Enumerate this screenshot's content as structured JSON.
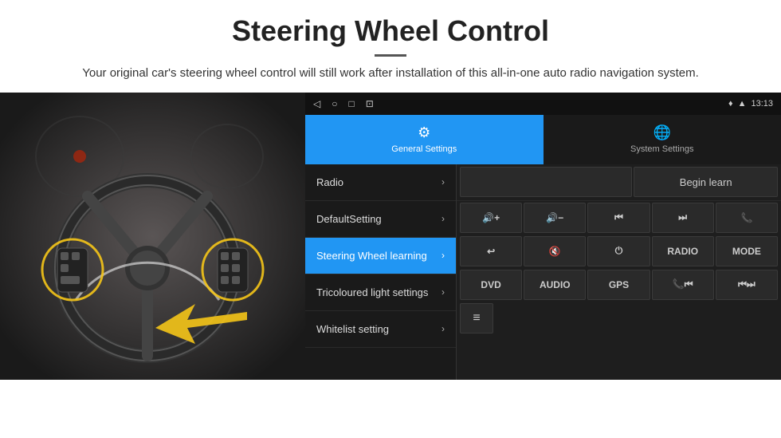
{
  "header": {
    "title": "Steering Wheel Control",
    "description": "Your original car's steering wheel control will still work after installation of this all-in-one auto radio navigation system."
  },
  "status_bar": {
    "time": "13:13",
    "nav_icons": [
      "◁",
      "○",
      "□",
      "⊡"
    ]
  },
  "tabs": [
    {
      "label": "General Settings",
      "icon": "⚙",
      "active": true
    },
    {
      "label": "System Settings",
      "icon": "🌐",
      "active": false
    }
  ],
  "menu_items": [
    {
      "label": "Radio",
      "active": false
    },
    {
      "label": "DefaultSetting",
      "active": false
    },
    {
      "label": "Steering Wheel learning",
      "active": true
    },
    {
      "label": "Tricoloured light settings",
      "active": false
    },
    {
      "label": "Whitelist setting",
      "active": false
    }
  ],
  "panel": {
    "begin_learn": "Begin learn",
    "buttons_row2": [
      "🔊+",
      "🔊—",
      "⏮",
      "⏭",
      "📞"
    ],
    "buttons_row3": [
      "↩",
      "🔊✕",
      "⏻",
      "RADIO",
      "MODE"
    ],
    "buttons_row4": [
      "DVD",
      "AUDIO",
      "GPS",
      "📞⏮",
      "⏮⏭"
    ],
    "buttons_row5_icon": "≡"
  }
}
